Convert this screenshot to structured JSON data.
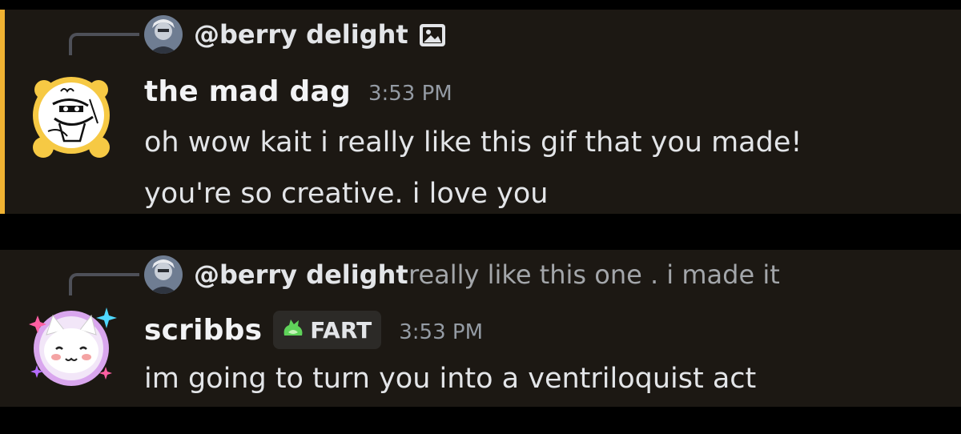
{
  "messages": [
    {
      "reply": {
        "name": "@berry delight",
        "attachment_icon": "image-icon"
      },
      "author": "the mad dag",
      "timestamp": "3:53 PM",
      "lines": [
        "oh wow kait i really like this gif that you made!",
        "you're so creative. i love you"
      ],
      "highlight_color": "#f0b232"
    },
    {
      "reply": {
        "name": "@berry delight",
        "preview": "really like this one . i made it"
      },
      "author": "scribbs",
      "tag": {
        "icon": "green-blob-icon",
        "label": "FART"
      },
      "timestamp": "3:53 PM",
      "lines": [
        "im going to turn you into a ventriloquist act"
      ]
    }
  ],
  "colors": {
    "background": "#000000",
    "message_bg": "#1c1813",
    "mention_bar": "#f0b232",
    "text": "#e3e5e8",
    "muted": "#949ba4"
  }
}
